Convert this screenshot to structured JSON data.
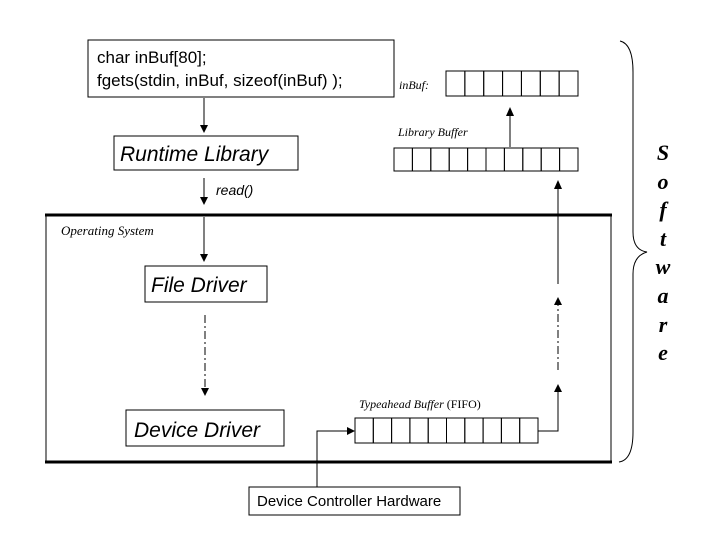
{
  "code_box": {
    "line1": "char inBuf[80];",
    "line2": "fgets(stdin, inBuf, sizeof(inBuf) );"
  },
  "inbuf_label": "inBuf:",
  "inbuf_cells": 7,
  "library_buffer_label": "Library Buffer",
  "library_buffer_cells": 10,
  "runtime_library_label": "Runtime Library",
  "read_call_label": "read()",
  "os_label": "Operating System",
  "file_driver_label": "File Driver",
  "device_driver_label": "Device Driver",
  "typeahead_label_italic": "Typeahead Buffer",
  "typeahead_label_suffix": " (FIFO)",
  "typeahead_cells": 10,
  "hardware_label": "Device Controller Hardware",
  "software_letters": [
    "S",
    "o",
    "f",
    "t",
    "w",
    "a",
    "r",
    "e"
  ],
  "colors": {
    "ink": "#000000",
    "background": "#ffffff"
  }
}
